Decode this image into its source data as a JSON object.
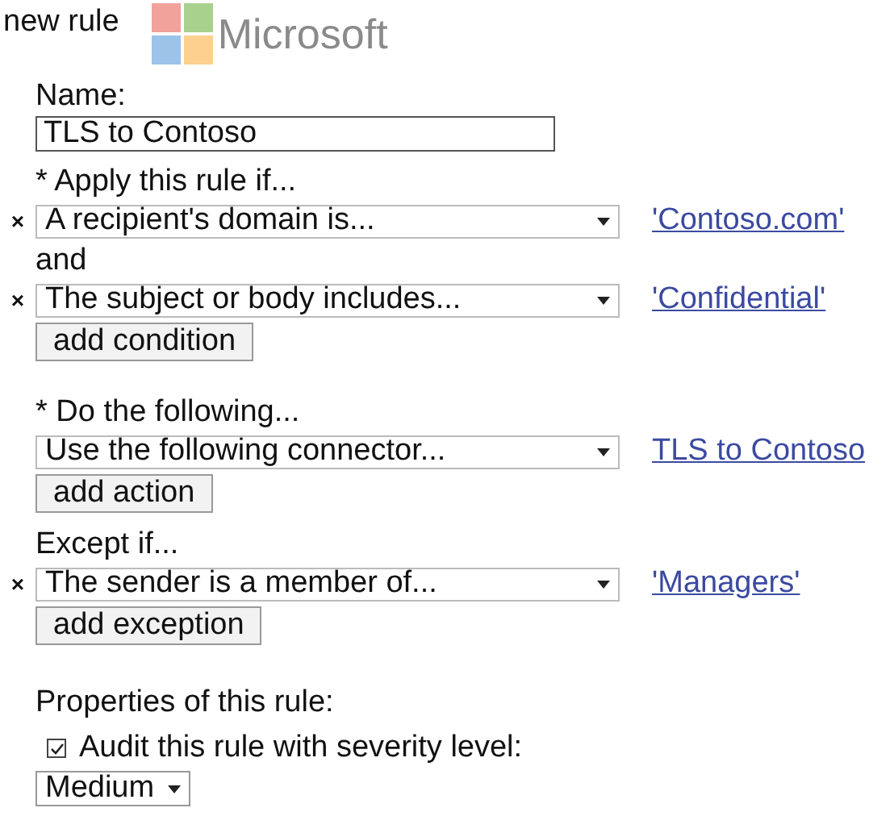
{
  "title": "new rule",
  "logo": {
    "text": "Microsoft"
  },
  "name": {
    "label": "Name:",
    "value": "TLS to Contoso"
  },
  "sections": [
    {
      "heading": "* Apply this rule if...",
      "button": "add condition",
      "rows": [
        {
          "kind": "condition",
          "remove": "×",
          "value": "A recipient's domain is...",
          "link": "'Contoso.com'"
        },
        {
          "kind": "joiner",
          "text": "and"
        },
        {
          "kind": "condition",
          "remove": "×",
          "value": "The subject or body includes...",
          "link": "'Confidential'"
        }
      ]
    },
    {
      "heading": "* Do the following...",
      "button": "add action",
      "rows": [
        {
          "kind": "condition",
          "value": "Use the following connector...",
          "link": "TLS to Contoso"
        }
      ]
    },
    {
      "heading": "Except if...",
      "button": "add exception",
      "rows": [
        {
          "kind": "condition",
          "remove": "×",
          "value": "The sender is a member of...",
          "link": "'Managers'"
        }
      ]
    }
  ],
  "properties": {
    "heading": "Properties of this rule:",
    "audit": {
      "checked": true,
      "label": "Audit this rule with severity level:"
    },
    "severity": "Medium"
  }
}
